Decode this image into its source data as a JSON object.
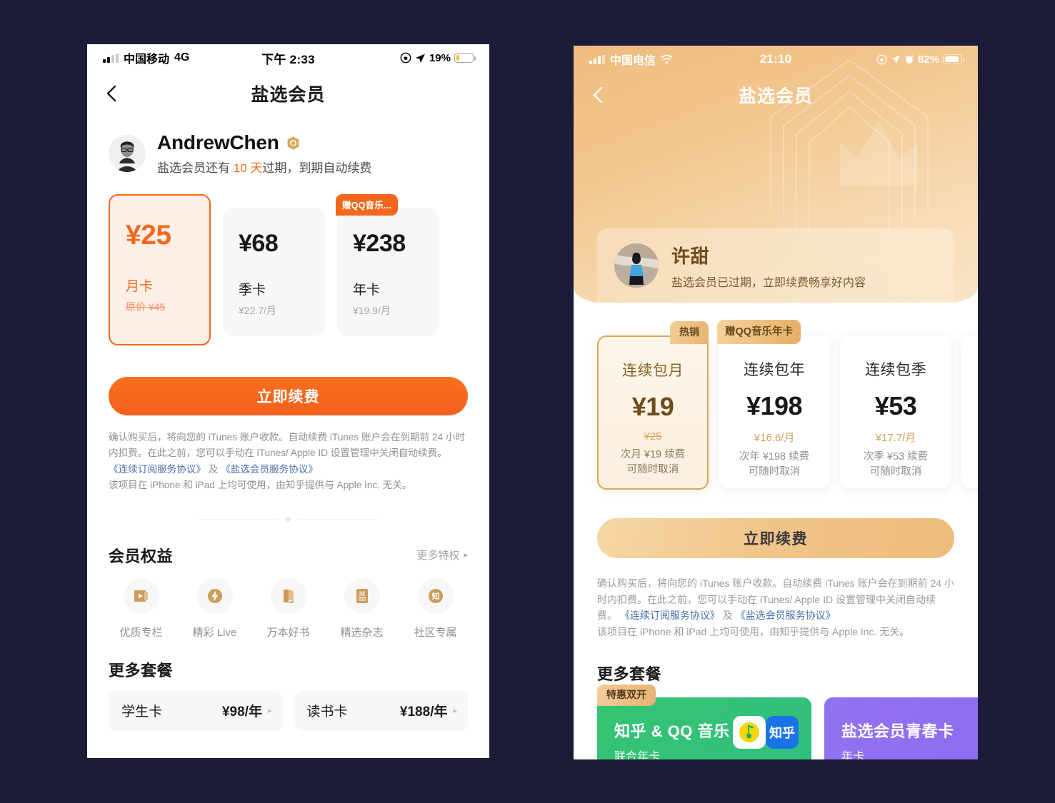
{
  "background_color": "#1c1c38",
  "left_phone": {
    "status_bar": {
      "carrier": "中国移动",
      "network": "4G",
      "time": "下午 2:33",
      "battery_percent": "19%",
      "icons": [
        "signal-bars-icon",
        "lock-rotation-icon",
        "location-arrow-icon",
        "battery-icon"
      ]
    },
    "nav": {
      "back_icon": "chevron-left-icon",
      "title": "盐选会员"
    },
    "user": {
      "name": "AndrewChen",
      "badge_icon": "member-hexagon-badge-icon",
      "subtitle_prefix": "盐选会员还有 ",
      "subtitle_highlight": "10 天",
      "subtitle_suffix": "过期，到期自动续费",
      "avatar_icon": "user-avatar"
    },
    "plans": [
      {
        "price": "¥25",
        "plan": "月卡",
        "original": "原价 ¥45",
        "selected": true,
        "tag": ""
      },
      {
        "price": "¥68",
        "plan": "季卡",
        "original": "¥22.7/月",
        "selected": false,
        "tag": ""
      },
      {
        "price": "¥238",
        "plan": "年卡",
        "original": "¥19.9/月",
        "selected": false,
        "tag": "赠QQ音乐..."
      }
    ],
    "cta_label": "立即续费",
    "fine_print": {
      "line1": "确认购买后，将向您的 iTunes 账户收款。自动续费 iTunes 账户会在到期前 24 小时内扣费。在此之前，您可以手动在 iTunes/ Apple ID 设置管理中关闭自动续费。",
      "link1": "《连续订阅服务协议》",
      "between": " 及 ",
      "link2": "《盐选会员服务协议》",
      "line3": "该项目在 iPhone 和 iPad 上均可使用，由知乎提供与 Apple Inc. 无关。"
    },
    "benefits": {
      "title": "会员权益",
      "more_label": "更多特权",
      "more_caret": "▸",
      "items": [
        {
          "label": "优质专栏",
          "icon": "play-column-icon"
        },
        {
          "label": "精彩 Live",
          "icon": "lightning-live-icon"
        },
        {
          "label": "万本好书",
          "icon": "open-book-icon"
        },
        {
          "label": "精选杂志",
          "icon": "magazine-m-icon"
        },
        {
          "label": "社区专属",
          "icon": "zhihu-circle-icon"
        }
      ]
    },
    "more_packages": {
      "title": "更多套餐",
      "items": [
        {
          "name": "学生卡",
          "price": "¥98/年",
          "caret": "▸"
        },
        {
          "name": "读书卡",
          "price": "¥188/年",
          "caret": "▸"
        }
      ]
    }
  },
  "right_phone": {
    "status_bar": {
      "carrier": "中国电信",
      "network_icon": "wifi-icon",
      "time": "21:10",
      "battery_percent": "82%",
      "icons": [
        "signal-bars-icon",
        "lock-rotation-icon",
        "location-arrow-icon",
        "alarm-icon",
        "battery-icon"
      ]
    },
    "nav": {
      "back_icon": "chevron-left-icon",
      "title": "盐选会员"
    },
    "hero": {
      "crown_icon": "crown-watermark-icon",
      "accent": "#e8b471"
    },
    "user": {
      "name": "许甜",
      "subtitle": "盐选会员已过期，立即续费畅享好内容",
      "avatar_icon": "user-avatar"
    },
    "plans": [
      {
        "plan": "连续包月",
        "price": "¥19",
        "sub": "¥25",
        "note_line1": "次月 ¥19 续费",
        "note_line2": "可随时取消",
        "tag": "热销",
        "tag_wide": false,
        "selected": true
      },
      {
        "plan": "连续包年",
        "price": "¥198",
        "sub": "¥16.6/月",
        "note_line1": "次年 ¥198 续费",
        "note_line2": "可随时取消",
        "tag": "赠QQ音乐年卡",
        "tag_wide": true,
        "selected": false
      },
      {
        "plan": "连续包季",
        "price": "¥53",
        "sub": "¥17.7/月",
        "note_line1": "次季 ¥53 续费",
        "note_line2": "可随时取消",
        "tag": "",
        "tag_wide": false,
        "selected": false
      }
    ],
    "cta_label": "立即续费",
    "fine_print": {
      "line1": "确认购买后，将向您的 iTunes 账户收款。自动续费 iTunes 账户会在到期前 24 小时内扣费。在此之前，您可以手动在 iTunes/ Apple ID 设置管理中关闭自动续费。",
      "link1": "《连续订阅服务协议》",
      "between": " 及 ",
      "link2": "《盐选会员服务协议》",
      "line3": "该项目在 iPhone 和 iPad 上均可使用，由知乎提供与 Apple Inc. 无关。"
    },
    "more_packages": {
      "title": "更多套餐",
      "items": [
        {
          "title": "知乎 & QQ 音乐",
          "sub": "联合年卡",
          "tag": "特惠双开",
          "color": "#35c473",
          "logo_zhihu": "知乎",
          "logo_qq": "qq-music-icon"
        },
        {
          "title": "盐选会员青春卡",
          "sub": "年卡",
          "tag": "",
          "color": "#9272f0",
          "art": "youth-card-art"
        }
      ]
    }
  }
}
